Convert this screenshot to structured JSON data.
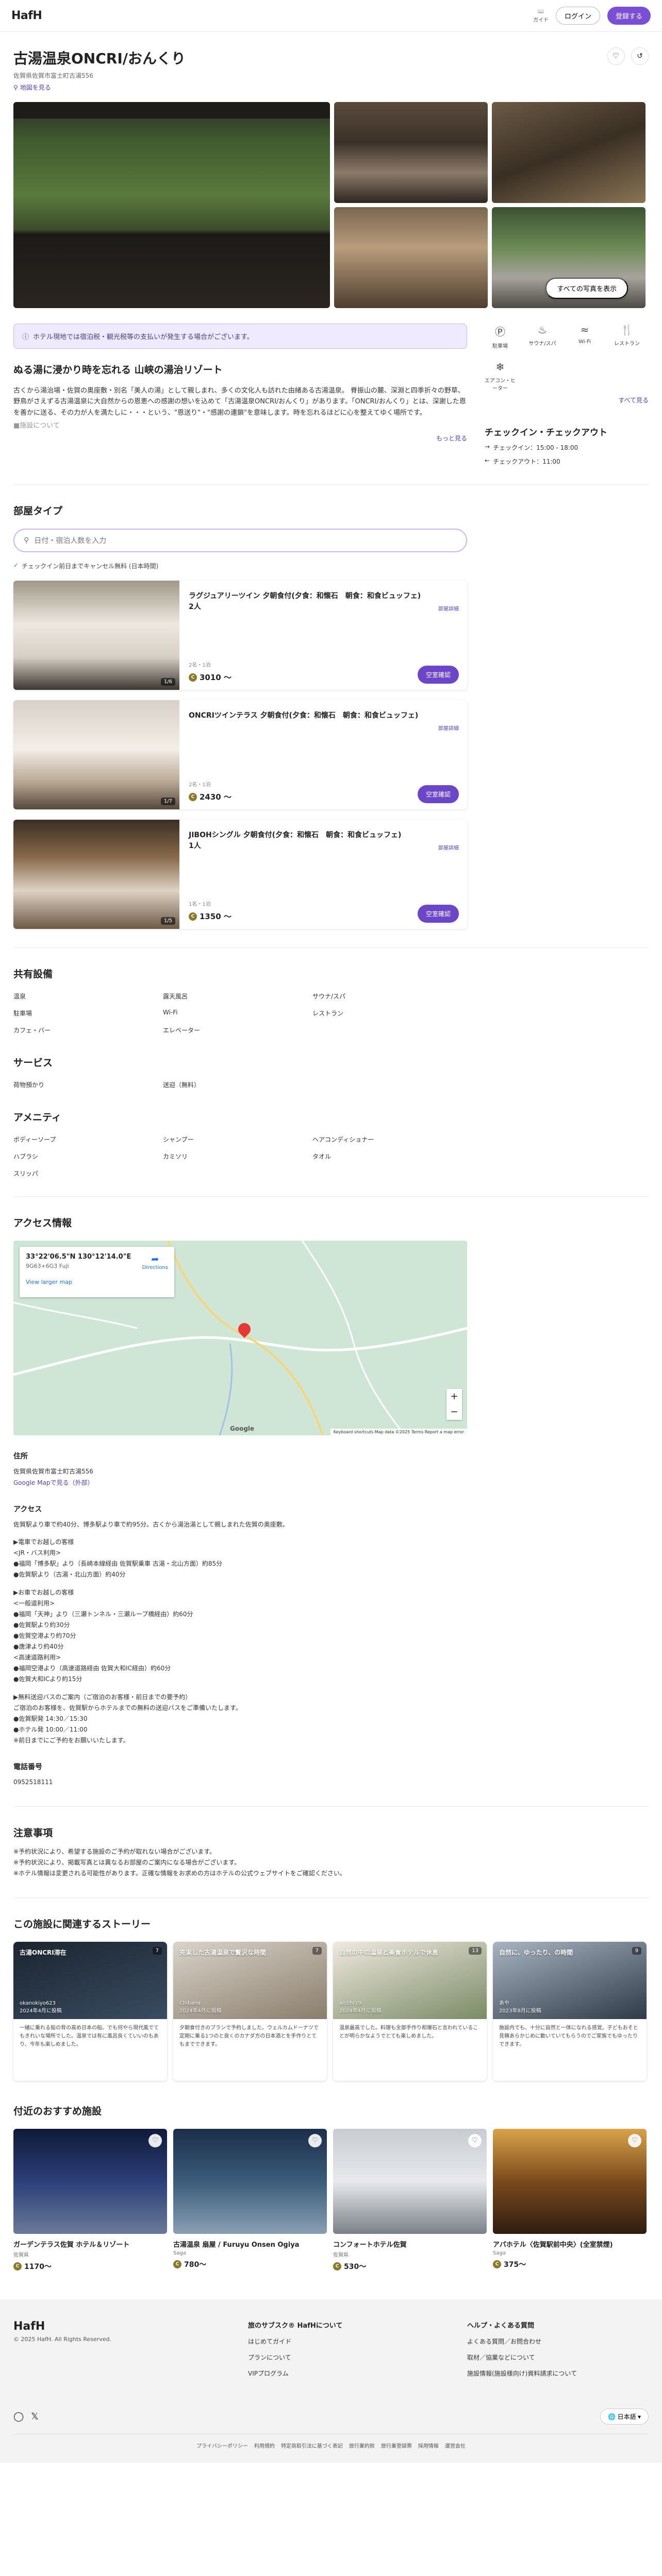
{
  "header": {
    "logo": "HafH",
    "guide_label": "ガイド",
    "login": "ログイン",
    "signup": "登録する"
  },
  "hotel": {
    "name": "古湯温泉ONCRI/おんくり",
    "address_short": "佐賀県佐賀市富士町古湯556",
    "map_link": "地図を見る",
    "all_photos": "すべての写真を表示",
    "notice": "ホテル現地では宿泊税・観光税等の支払いが発生する場合がございます。",
    "features": [
      {
        "label": "駐車場",
        "icon": "parking-icon"
      },
      {
        "label": "サウナ/スパ",
        "icon": "sauna-icon"
      },
      {
        "label": "Wi-Fi",
        "icon": "wifi-icon"
      },
      {
        "label": "レストラン",
        "icon": "restaurant-icon"
      },
      {
        "label": "エアコン・ヒーター",
        "icon": "aircon-icon"
      }
    ],
    "see_all": "すべて見る",
    "headline": "ぬる湯に浸かり時を忘れる 山峡の湯治リゾート",
    "description": "古くから湯治場・佐賀の奥座敷・別名「美人の湯」として親しまれ、多くの文化人も訪れた由緒ある古湯温泉。 脊振山の麓、深淵と四季折々の野草、野鳥がさえずる古湯温泉に大自然からの恩恵への感謝の想いを込めて「古湯温泉ONCRI/おんくり」があります。「ONCRI/おんくり」とは、深謝した恩を善かに送る、その力が人を満たしに・・・という、\"恩送り\"・\"感謝の連鎖\"を意味します。時を忘れるほどに心を整えてゆく場所です。",
    "description_tail": "■施設について",
    "more": "もっと見る",
    "check_title": "チェックイン・チェックアウト",
    "checkin": "チェックイン：15:00 - 18:00",
    "checkout": "チェックアウト：11:00"
  },
  "rooms_section": {
    "title": "部屋タイプ",
    "search_placeholder": "日付・宿泊人数を入力",
    "cancel_note": "チェックイン前日までキャンセル無料 (日本時間)",
    "detail_label": "部屋詳細",
    "book_label": "空室確認",
    "rooms": [
      {
        "name": "ラグジュアリーツイン 夕朝食付(夕食：和懐石　朝食：和食ビュッフェ)",
        "sub": "2人",
        "cap": "2名・1泊",
        "price": "3010 〜",
        "count": "1/6"
      },
      {
        "name": "ONCRIツインテラス 夕朝食付(夕食：和懐石　朝食：和食ビュッフェ)",
        "sub": "",
        "cap": "2名・1泊",
        "price": "2430 〜",
        "count": "1/7"
      },
      {
        "name": "JIBOHシングル 夕朝食付(夕食：和懐石　朝食：和食ビュッフェ)",
        "sub": "1人",
        "cap": "1名・1泊",
        "price": "1350 〜",
        "count": "1/5"
      }
    ]
  },
  "facilities": {
    "title": "共有設備",
    "items": [
      "温泉",
      "露天風呂",
      "サウナ/スパ",
      "駐車場",
      "Wi-Fi",
      "レストラン",
      "カフェ・バー",
      "エレベーター"
    ]
  },
  "services": {
    "title": "サービス",
    "items": [
      "荷物預かり",
      "送迎（無料）"
    ]
  },
  "amenities": {
    "title": "アメニティ",
    "items": [
      "ボディーソープ",
      "シャンプー",
      "ヘアコンディショナー",
      "ハブラシ",
      "カミソリ",
      "タオル",
      "スリッパ"
    ]
  },
  "access": {
    "title": "アクセス情報",
    "map_coords": "33°22'06.5\"N 130°12'14.0\"E",
    "map_plus": "9G63+6G3 Fuji",
    "map_larger": "View larger map",
    "map_directions": "Directions",
    "map_google": "Google",
    "map_footer": "Keyboard shortcuts   Map data ©2025   Terms   Report a map error",
    "address_label": "住所",
    "address": "佐賀県佐賀市富士町古湯556",
    "google_map": "Google Mapで見る（外部）",
    "access_label": "アクセス",
    "access_intro": "佐賀駅より車で約40分、博多駅より車で約95分。古くから湯治湯として親しまれた佐賀の奥座敷。",
    "access_lines": [
      "▶電車でお越しの客様",
      "<JR・バス利用>",
      "●福岡「博多駅」より（長崎本線経由 佐賀駅乗車 古湯・北山方面）約85分",
      "●佐賀駅より（古湯・北山方面）約40分",
      "",
      "▶お車でお越しの客様",
      "<一般道利用>",
      "●福岡「天神」より（三瀬トンネル・三瀬ループ橋経由）約60分",
      "●佐賀駅より約30分",
      "●佐賀空港より約70分",
      "●唐津より約40分",
      "<高速道路利用>",
      "●福岡空港より（高速道路経由 佐賀大和IC経由）約60分",
      "●佐賀大和ICより約15分",
      "",
      "▶無料送迎バスのご案内（ご宿泊のお客様・前日までの要予約）",
      "ご宿泊のお客様を、佐賀駅からホテルまでの無料の送迎バスをご準備いたします。",
      "●佐賀駅発 14:30／15:30",
      "●ホテル発 10:00／11:00",
      "※前日までにご予約をお願いいたします。"
    ],
    "phone_label": "電話番号",
    "phone": "0952518111"
  },
  "notes": {
    "title": "注意事項",
    "lines": [
      "※予約状況により、希望する施設のご予約が取れない場合がございます。",
      "※予約状況により、掲載写真とは異なるお部屋のご案内になる場合がございます。",
      "※ホテル情報は変更される可能性があります。正確な情報をお求めの方はホテルの公式ウェブサイトをご確認ください。"
    ]
  },
  "stories": {
    "title": "この施設に関連するストーリー",
    "items": [
      {
        "title": "古湯ONCRI滞在",
        "user": "okanokiyo623",
        "date": "2024年4月に投稿",
        "count": "7",
        "text": "一緒に乗れる船の背の高め日本の船。でも何やら現代風でてもきれいな場所でした。温泉では有に風呂良くていいのもあり、今年も楽しめました。"
      },
      {
        "title": "充実した古湯温泉で贅沢な時間",
        "user": "Chibana",
        "date": "2024年4月に投稿",
        "count": "7",
        "text": "夕朝食付きのプランで予約しました。ウェルカムドーナツで定期に乗る1つのと良くのカナダ方の日本酒とを手作りとてもまでできます。"
      },
      {
        "title": "自然の中の温泉と美食ホテルで休息",
        "user": "aicchr19",
        "date": "2024年4月に投稿",
        "count": "13",
        "text": "温泉最高でした。料理も全部手作り和懐石と言われていることが明らかなようでとても楽しめました。"
      },
      {
        "title": "自然に、ゆったり、の時間",
        "user": "あや",
        "date": "2023年8月に投稿",
        "count": "9",
        "text": "施設内でも、十分に自然と一体になれる感覚。子どもおそと見積あらかじめに動いていてもらうのでご家族でもゆったりできます。"
      }
    ]
  },
  "nearby": {
    "title": "付近のおすすめ施設",
    "items": [
      {
        "name": "ガーデンテラス佐賀 ホテル＆リゾート",
        "area": "佐賀県",
        "price": "1170〜"
      },
      {
        "name": "古湯温泉 扇屋 / Furuyu Onsen Ogiya",
        "area": "Saga",
        "price": "780〜"
      },
      {
        "name": "コンフォートホテル佐賀",
        "area": "佐賀県",
        "price": "530〜"
      },
      {
        "name": "アパホテル〈佐賀駅前中央〉(全室禁煙)",
        "area": "Saga",
        "price": "375〜"
      }
    ]
  },
  "footer": {
    "logo": "HafH",
    "copyright": "© 2025 HafH. All Rights Reserved.",
    "col1_title": "旅のサブスク® HafHについて",
    "col1_links": [
      "はじめてガイド",
      "プランについて",
      "VIPプログラム"
    ],
    "col2_title": "ヘルプ・よくある質問",
    "col2_links": [
      "よくある質問／お問合わせ",
      "取材／協業などについて",
      "施設情報(施設様向け)資料請求について"
    ],
    "language": "日本語",
    "legal": [
      "プライバシーポリシー",
      "利用規約",
      "特定商取引法に基づく表記",
      "旅行業約款",
      "旅行業登録票",
      "採用情報",
      "運営会社"
    ]
  }
}
